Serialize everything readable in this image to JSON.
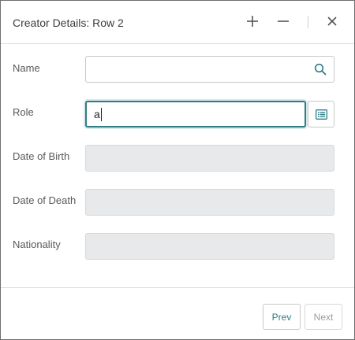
{
  "dialog": {
    "title": "Creator Details: Row 2"
  },
  "header": {
    "icons": [
      "plus-icon",
      "minus-icon",
      "close-icon"
    ]
  },
  "form": {
    "name": {
      "label": "Name",
      "value": "",
      "icon": "search-icon"
    },
    "role": {
      "label": "Role",
      "value": "a",
      "icon": "list-icon"
    },
    "date_of_birth": {
      "label": "Date of Birth",
      "value": ""
    },
    "date_of_death": {
      "label": "Date of Death",
      "value": ""
    },
    "nationality": {
      "label": "Nationality",
      "value": ""
    }
  },
  "footer": {
    "prev_label": "Prev",
    "next_label": "Next"
  },
  "colors": {
    "accent": "#2e7d86",
    "disabled_field": "#e8e9ea",
    "border": "#c8c8c8"
  }
}
